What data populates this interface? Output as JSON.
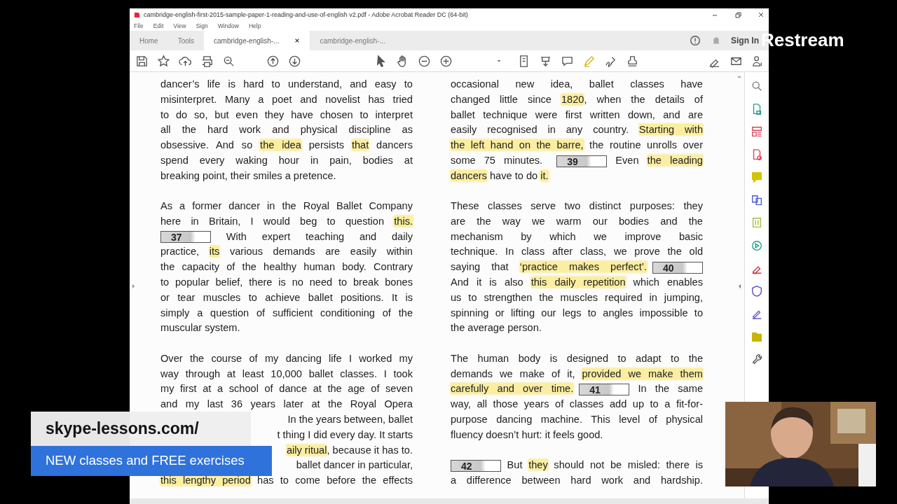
{
  "window": {
    "title": "cambridge-english-first-2015-sample-paper-1-reading-and-use-of-english v2.pdf - Adobe Acrobat Reader DC (64-bit)"
  },
  "menu": [
    "File",
    "Edit",
    "View",
    "Sign",
    "Window",
    "Help"
  ],
  "tabs": [
    {
      "label": "Home",
      "selected": false,
      "closable": false
    },
    {
      "label": "Tools",
      "selected": false,
      "closable": false
    },
    {
      "label": "cambridge-english-...",
      "selected": true,
      "closable": true
    },
    {
      "label": "cambridge-english-...",
      "selected": false,
      "closable": false
    }
  ],
  "sign_in": "Sign In",
  "document": {
    "columns": [
      {
        "paragraphs": [
          {
            "lines": [
              {
                "kind": "full",
                "text": "dancer’s life is hard to understand, and easy to"
              },
              {
                "kind": "full",
                "text": "misinterpret. Many a poet and novelist has tried"
              },
              {
                "kind": "full",
                "text": "to do so, but even they have chosen to interpret"
              },
              {
                "kind": "full",
                "text": "all the hard work and physical discipline as"
              },
              {
                "kind": "full",
                "parts": [
                  {
                    "kind": "plain",
                    "text": "obsessive. And so "
                  },
                  {
                    "kind": "highlight",
                    "text": "the idea"
                  },
                  {
                    "kind": "plain",
                    "text": " persists "
                  },
                  {
                    "kind": "highlight",
                    "text": "that"
                  },
                  {
                    "kind": "plain",
                    "text": " dancers"
                  }
                ]
              },
              {
                "kind": "full",
                "text": "spend every waking hour in pain, bodies at"
              },
              {
                "kind": "last",
                "text": "breaking point, their smiles a pretence."
              }
            ]
          },
          {
            "lines": [
              {
                "kind": "full",
                "text": "As a former dancer in the Royal Ballet Company"
              },
              {
                "kind": "full",
                "parts": [
                  {
                    "kind": "plain",
                    "text": "here in Britain, I would beg to question "
                  },
                  {
                    "kind": "highlight",
                    "text": "this."
                  }
                ]
              },
              {
                "kind": "full",
                "parts": [
                  {
                    "kind": "gap",
                    "text": "37"
                  },
                  {
                    "kind": "plain",
                    "text": " With expert teaching and daily"
                  }
                ]
              },
              {
                "kind": "full",
                "parts": [
                  {
                    "kind": "plain",
                    "text": "practice, "
                  },
                  {
                    "kind": "highlight",
                    "text": "its"
                  },
                  {
                    "kind": "plain",
                    "text": " various demands are easily within"
                  }
                ]
              },
              {
                "kind": "full",
                "text": "the capacity of the healthy human body. Contrary"
              },
              {
                "kind": "full",
                "text": "to popular belief, there is no need to break bones"
              },
              {
                "kind": "full",
                "text": "or tear muscles to achieve ballet positions. It is"
              },
              {
                "kind": "full",
                "text": "simply a question of sufficient conditioning of the"
              },
              {
                "kind": "last",
                "text": "muscular system."
              }
            ]
          },
          {
            "lines": [
              {
                "kind": "full",
                "text": "Over the course of my dancing life I worked my"
              },
              {
                "kind": "full",
                "text": "way through at least 10,000 ballet classes. I took"
              },
              {
                "kind": "full",
                "text": "my first at a school of dance at the age of seven"
              },
              {
                "kind": "full",
                "text": "and my last 36 years later at the Royal Opera"
              },
              {
                "kind": "tail",
                "text": "In the years between, ballet"
              },
              {
                "kind": "tail",
                "text": "t thing I did every day. It starts"
              },
              {
                "kind": "tail",
                "parts": [
                  {
                    "kind": "highlight",
                    "text": "aily ritual"
                  },
                  {
                    "kind": "plain",
                    "text": ", because it has to."
                  }
                ]
              },
              {
                "kind": "tail",
                "text": "ballet dancer in particular,"
              },
              {
                "kind": "full",
                "parts": [
                  {
                    "kind": "highlight",
                    "text": "this lengthy period"
                  },
                  {
                    "kind": "plain",
                    "text": " has to come before the effects"
                  }
                ]
              }
            ]
          }
        ]
      },
      {
        "paragraphs": [
          {
            "lines": [
              {
                "kind": "full",
                "text": "occasional new idea, ballet classes have"
              },
              {
                "kind": "full",
                "parts": [
                  {
                    "kind": "plain",
                    "text": "changed little since "
                  },
                  {
                    "kind": "highlight",
                    "text": "1820"
                  },
                  {
                    "kind": "plain",
                    "text": ", when the details of"
                  }
                ]
              },
              {
                "kind": "full",
                "text": "ballet technique were first written down, and are"
              },
              {
                "kind": "full",
                "parts": [
                  {
                    "kind": "plain",
                    "text": "easily recognised in any country. "
                  },
                  {
                    "kind": "highlight",
                    "text": "Starting with"
                  }
                ]
              },
              {
                "kind": "full",
                "parts": [
                  {
                    "kind": "highlight",
                    "text": "the left hand on the barre,"
                  },
                  {
                    "kind": "plain",
                    "text": " the routine unrolls over"
                  }
                ]
              },
              {
                "kind": "full",
                "parts": [
                  {
                    "kind": "plain",
                    "text": "some 75 minutes. "
                  },
                  {
                    "kind": "gap",
                    "text": "39"
                  },
                  {
                    "kind": "plain",
                    "text": " Even "
                  },
                  {
                    "kind": "highlight",
                    "text": "the leading"
                  }
                ]
              },
              {
                "kind": "last",
                "parts": [
                  {
                    "kind": "highlight",
                    "text": "dancers"
                  },
                  {
                    "kind": "plain",
                    "text": " have to do "
                  },
                  {
                    "kind": "highlight",
                    "text": "it."
                  }
                ]
              }
            ]
          },
          {
            "lines": [
              {
                "kind": "full",
                "text": "These classes serve two distinct purposes: they"
              },
              {
                "kind": "full",
                "text": "are the way we warm our bodies and the"
              },
              {
                "kind": "full",
                "text": "mechanism by which we improve basic"
              },
              {
                "kind": "full",
                "text": "technique. In class after class, we prove the old"
              },
              {
                "kind": "full",
                "parts": [
                  {
                    "kind": "plain",
                    "text": "saying that "
                  },
                  {
                    "kind": "highlight",
                    "text": "‘practice makes perfect’."
                  },
                  {
                    "kind": "gap",
                    "text": "40"
                  }
                ]
              },
              {
                "kind": "full",
                "parts": [
                  {
                    "kind": "plain",
                    "text": "And it is also "
                  },
                  {
                    "kind": "highlight",
                    "text": "this daily repetition"
                  },
                  {
                    "kind": "plain",
                    "text": " which enables"
                  }
                ]
              },
              {
                "kind": "full",
                "text": "us to strengthen the muscles required in jumping,"
              },
              {
                "kind": "full",
                "text": "spinning or lifting our legs to angles impossible to"
              },
              {
                "kind": "last",
                "text": "the average person."
              }
            ]
          },
          {
            "lines": [
              {
                "kind": "full",
                "text": "The human body is designed to adapt to the"
              },
              {
                "kind": "full",
                "parts": [
                  {
                    "kind": "plain",
                    "text": "demands we make of it, "
                  },
                  {
                    "kind": "highlight",
                    "text": "provided we make them"
                  }
                ]
              },
              {
                "kind": "full",
                "parts": [
                  {
                    "kind": "highlight",
                    "text": "carefully and over time."
                  },
                  {
                    "kind": "gap",
                    "text": "41"
                  },
                  {
                    "kind": "plain",
                    "text": " In the same"
                  }
                ]
              },
              {
                "kind": "full",
                "text": "way, all those years of classes add up to a fit-for-"
              },
              {
                "kind": "full",
                "text": "purpose dancing machine. This level of physical"
              },
              {
                "kind": "last",
                "text": "fluency doesn’t hurt: it feels good."
              }
            ]
          },
          {
            "lines": [
              {
                "kind": "full",
                "parts": [
                  {
                    "kind": "gap",
                    "text": "42"
                  },
                  {
                    "kind": "plain",
                    "text": " But "
                  },
                  {
                    "kind": "highlight",
                    "text": "they"
                  },
                  {
                    "kind": "plain",
                    "text": " should not be misled: there is"
                  }
                ]
              },
              {
                "kind": "full",
                "text": "a difference between hard work and hardship."
              }
            ]
          }
        ]
      }
    ]
  },
  "overlays": {
    "brand": "Restream",
    "banner": {
      "url": "skype-lessons.com/",
      "tagline": "NEW classes and FREE exercises"
    }
  }
}
